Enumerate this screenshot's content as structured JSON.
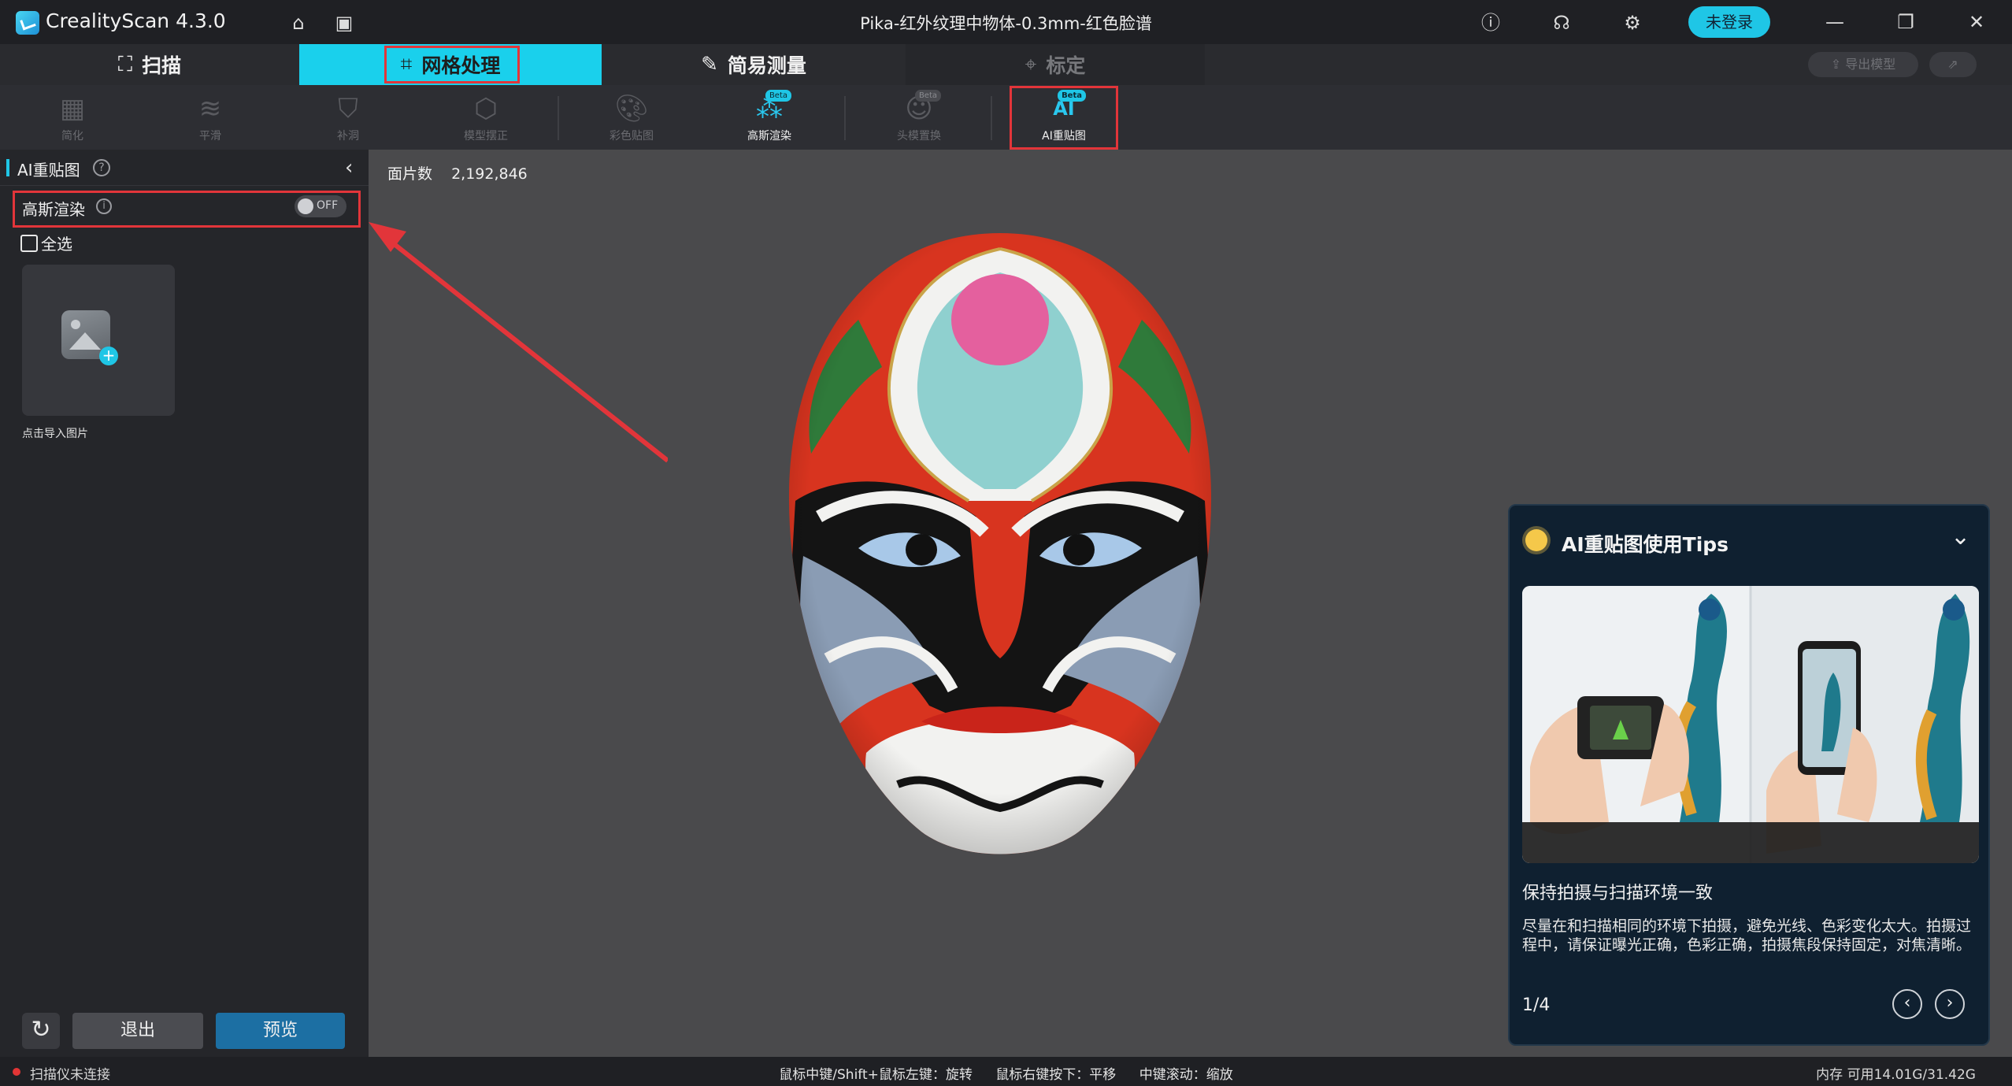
{
  "app": {
    "name": "CrealityScan 4.3.0",
    "document_title": "Pika-红外纹理中物体-0.3mm-红色脸谱",
    "login_label": "未登录"
  },
  "main_tabs": [
    {
      "label": "扫描",
      "icon": "scan-icon"
    },
    {
      "label": "网格处理",
      "icon": "mesh-crop-icon"
    },
    {
      "label": "简易测量",
      "icon": "ruler-icon"
    },
    {
      "label": "标定",
      "icon": "target-icon"
    }
  ],
  "export": {
    "label": "导出模型"
  },
  "tools": [
    {
      "label": "简化",
      "icon": "simplify-icon"
    },
    {
      "label": "平滑",
      "icon": "smooth-icon"
    },
    {
      "label": "补洞",
      "icon": "fill-hole-icon"
    },
    {
      "label": "模型摆正",
      "icon": "align-model-icon"
    },
    {
      "label": "彩色贴图",
      "icon": "palette-icon"
    },
    {
      "label": "高斯渲染",
      "icon": "gaussian-icon",
      "badge": "Beta"
    },
    {
      "label": "头模置换",
      "icon": "head-swap-icon",
      "badge": "Beta"
    },
    {
      "label": "AI重贴图",
      "icon": "ai-retexture-icon",
      "badge": "Beta"
    }
  ],
  "left_panel": {
    "title": "AI重贴图",
    "gaussian_label": "高斯渲染",
    "gaussian_toggle": "OFF",
    "select_all": "全选",
    "upload_label": "点击导入图片",
    "exit_label": "退出",
    "preview_label": "预览"
  },
  "viewport": {
    "face_count_label": "面片数",
    "face_count_value": "2,192,846"
  },
  "tips": {
    "title": "AI重贴图使用Tips",
    "subtitle": "保持拍摄与扫描环境一致",
    "body": "尽量在和扫描相同的环境下拍摄，避免光线、色彩变化太大。拍摄过程中，请保证曝光正确，色彩正确，拍摄焦段保持固定，对焦清晰。",
    "page": "1/4"
  },
  "status": {
    "scanner": "扫描仪未连接",
    "hint_rotate": "鼠标中键/Shift+鼠标左键：旋转",
    "hint_pan": "鼠标右键按下：平移",
    "hint_zoom": "中键滚动：缩放",
    "memory": "内存 可用14.01G/31.42G"
  },
  "colors": {
    "accent": "#1ad0ec",
    "highlight_box": "#e2353a",
    "preview_button": "#1c6fa3"
  }
}
